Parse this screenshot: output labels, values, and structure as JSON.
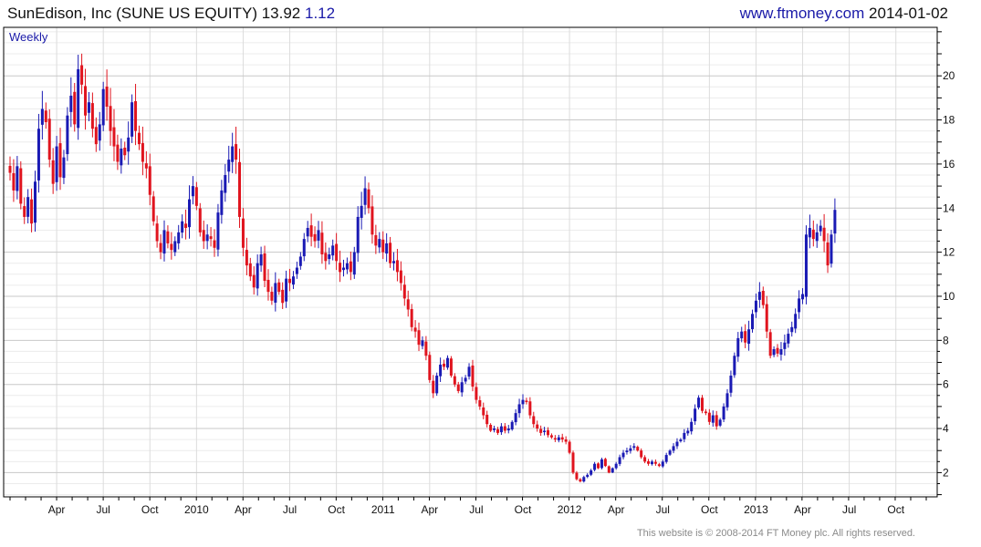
{
  "header": {
    "title": "SunEdison, Inc (SUNE US EQUITY)",
    "price": "13.92",
    "change": "1.12",
    "site": "www.ftmoney.com",
    "date": "2014-01-02"
  },
  "footer": "This website is © 2008-2014 FT Money plc. All rights reserved.",
  "colors": {
    "up": "#1a1ab4",
    "down": "#e0141e",
    "grid_major": "#c8c8c8",
    "grid_minor": "#ececec"
  },
  "chart_data": {
    "type": "ohlc-bar",
    "period_label": "Weekly",
    "y_axis_side": "right",
    "ylim": [
      0.9,
      22.2
    ],
    "yticks": [
      "2",
      "4",
      "6",
      "8",
      "10",
      "12",
      "14",
      "16",
      "18",
      "20"
    ],
    "x_labels": [
      "Apr",
      "Jul",
      "Oct",
      "2010",
      "Apr",
      "Jul",
      "Oct",
      "2011",
      "Apr",
      "Jul",
      "Oct",
      "2012",
      "Apr",
      "Jul",
      "Oct",
      "2013",
      "Apr",
      "Jul",
      "Oct"
    ],
    "x_label_weeks": [
      13,
      26,
      39,
      52,
      65,
      78,
      91,
      104,
      117,
      130,
      143,
      156,
      169,
      182,
      195,
      208,
      221,
      234,
      247
    ],
    "grid": true,
    "approx_weekly_closes": [
      15.6,
      14.8,
      15.9,
      14.2,
      13.6,
      14.5,
      13.3,
      15.2,
      17.6,
      18.5,
      17.9,
      16.2,
      15.1,
      16.8,
      15.4,
      16.3,
      18.2,
      19.1,
      17.8,
      20.3,
      19.6,
      18.2,
      18.8,
      17.6,
      16.9,
      17.8,
      19.4,
      18.6,
      17.5,
      16.8,
      16.1,
      16.7,
      16.4,
      17.2,
      18.8,
      17.5,
      16.9,
      16.1,
      15.8,
      14.6,
      13.4,
      12.5,
      12.0,
      13.0,
      12.4,
      12.1,
      12.5,
      12.9,
      13.4,
      13.1,
      14.4,
      15.0,
      14.1,
      12.9,
      12.5,
      12.8,
      12.6,
      12.2,
      13.8,
      14.8,
      15.5,
      16.2,
      16.8,
      16.2,
      13.6,
      12.2,
      11.4,
      10.9,
      10.4,
      11.5,
      11.9,
      10.7,
      10.2,
      9.8,
      10.6,
      10.2,
      9.7,
      10.8,
      10.6,
      10.9,
      11.3,
      11.8,
      12.6,
      13.1,
      12.7,
      12.5,
      13.0,
      11.9,
      11.6,
      11.9,
      12.3,
      11.6,
      11.1,
      11.3,
      11.5,
      11.1,
      12.0,
      13.6,
      14.1,
      14.9,
      14.0,
      12.8,
      12.3,
      12.6,
      12.0,
      12.4,
      11.5,
      11.6,
      11.1,
      10.6,
      9.9,
      9.4,
      8.6,
      8.4,
      7.8,
      8.0,
      7.3,
      6.2,
      5.6,
      6.4,
      6.9,
      6.8,
      7.2,
      6.4,
      6.0,
      5.7,
      6.1,
      6.3,
      6.8,
      5.9,
      5.3,
      5.0,
      4.6,
      4.2,
      3.9,
      4.0,
      3.8,
      4.1,
      3.9,
      4.0,
      4.3,
      4.7,
      5.1,
      5.3,
      5.2,
      4.6,
      4.2,
      4.0,
      3.8,
      3.9,
      3.7,
      3.6,
      3.5,
      3.6,
      3.5,
      3.4,
      2.9,
      2.0,
      1.7,
      1.6,
      1.8,
      1.9,
      2.1,
      2.4,
      2.2,
      2.6,
      2.3,
      2.0,
      2.2,
      2.4,
      2.7,
      2.9,
      3.0,
      3.1,
      3.2,
      3.0,
      2.7,
      2.5,
      2.4,
      2.5,
      2.4,
      2.3,
      2.5,
      2.8,
      3.0,
      3.2,
      3.4,
      3.5,
      3.8,
      3.9,
      4.3,
      4.9,
      5.4,
      4.8,
      4.7,
      4.3,
      4.6,
      4.1,
      4.4,
      5.0,
      5.6,
      6.4,
      7.3,
      8.1,
      8.4,
      7.9,
      8.5,
      9.2,
      9.8,
      10.2,
      9.6,
      8.4,
      7.3,
      7.6,
      7.4,
      7.6,
      7.9,
      8.3,
      8.6,
      9.2,
      9.9,
      10.1,
      12.8,
      13.1,
      12.6,
      12.9,
      13.2,
      12.5,
      11.4,
      12.8,
      13.92
    ]
  }
}
